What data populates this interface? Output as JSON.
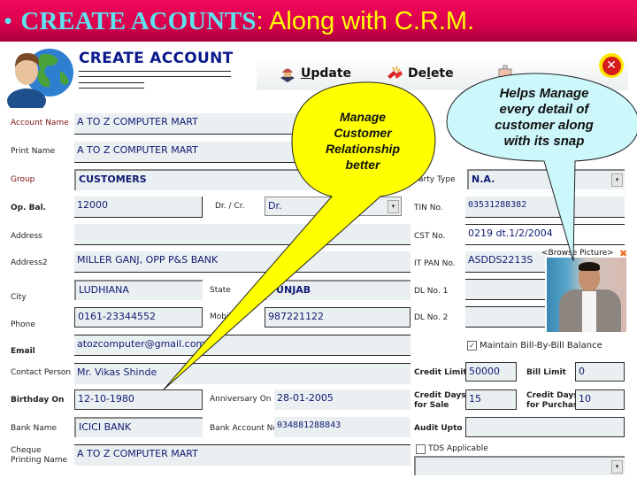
{
  "banner": {
    "bullet": "•",
    "title_cyan": "CREATE ACOUNTS",
    "title_yellow": ": Along with C.R.M."
  },
  "form": {
    "title": "CREATE ACCOUNT",
    "logo_icon": "user-globe-icon"
  },
  "toolbar": {
    "update_label": "Update",
    "update_accel": "U",
    "update_rest": "pdate",
    "delete_label": "Delete",
    "delete_pre": "De",
    "delete_accel": "l",
    "delete_rest": "ete",
    "close_glyph": "✕"
  },
  "fields": {
    "account_name": {
      "label": "Account Name",
      "value": "A TO Z COMPUTER MART"
    },
    "print_name": {
      "label": "Print Name",
      "value": "A TO Z COMPUTER MART"
    },
    "group": {
      "label": "Group",
      "value": "CUSTOMERS"
    },
    "op_bal": {
      "label": "Op. Bal.",
      "value": "12000"
    },
    "dr_cr": {
      "label": "Dr. / Cr.",
      "value": "Dr."
    },
    "address": {
      "label": "Address",
      "value": ""
    },
    "address2": {
      "label": "Address2",
      "value": "MILLER GANJ, OPP P&S BANK"
    },
    "city": {
      "label": "City",
      "value": "LUDHIANA"
    },
    "state": {
      "label": "State",
      "value": "PUNJAB"
    },
    "phone": {
      "label": "Phone",
      "value": "0161-23344552"
    },
    "mobile": {
      "label": "Mobile",
      "value": "987221122"
    },
    "email": {
      "label": "Email",
      "value": "atozcomputer@gmail.com"
    },
    "contact_person": {
      "label": "Contact Person",
      "value": "Mr. Vikas Shinde"
    },
    "birthday": {
      "label": "Birthday On",
      "value": "12-10-1980"
    },
    "anniversary": {
      "label": "Anniversary On",
      "value": "28-01-2005"
    },
    "bank_name": {
      "label": "Bank Name",
      "value": "ICICI BANK"
    },
    "bank_account": {
      "label": "Bank Account No.",
      "value": "034881288843"
    },
    "cheque_name": {
      "label_line1": "Cheque",
      "label_line2": "Printing Name",
      "value": "A TO Z COMPUTER MART"
    },
    "party_type": {
      "label": "Party Type",
      "value": "N.A."
    },
    "tin_no": {
      "label": "TIN No.",
      "value": "03531288382"
    },
    "cst_no": {
      "label": "CST No.",
      "value": "0219 dt.1/2/2004"
    },
    "it_pan": {
      "label": "IT PAN No.",
      "value": "ASDDS2213S"
    },
    "dl_no1": {
      "label": "DL No. 1",
      "value": ""
    },
    "dl_no2": {
      "label": "DL No. 2",
      "value": ""
    },
    "maintain_bill": {
      "label": "Maintain Bill-By-Bill Balance",
      "checked": true,
      "mark": "✓"
    },
    "credit_limit": {
      "label": "Credit Limit",
      "value": "50000"
    },
    "bill_limit": {
      "label": "Bill Limit",
      "value": "0"
    },
    "credit_days_sale": {
      "label_line1": "Credit Days",
      "label_line2": "for Sale",
      "value": "15"
    },
    "credit_days_purchase": {
      "label_line1": "Credit Days",
      "label_line2": "for Purchase",
      "value": "10"
    },
    "audit_upto": {
      "label": "Audit Upto",
      "value": ""
    },
    "tds_applicable": {
      "label": "TDS Applicable",
      "checked": false
    },
    "tds_select": {
      "value": ""
    }
  },
  "picture": {
    "browse_label": "<Browse Picture>",
    "remove_glyph": "✖"
  },
  "callouts": {
    "yellow": {
      "line1": "Manage",
      "line2": "Customer",
      "line3": "Relationship",
      "line4": "better",
      "color": "#ffff00"
    },
    "blue": {
      "line1": "Helps Manage",
      "line2": "every detail of",
      "line3": "customer along",
      "line4": "with its snap",
      "color": "#ccf7fb"
    }
  },
  "dropdown_glyph": "▾"
}
